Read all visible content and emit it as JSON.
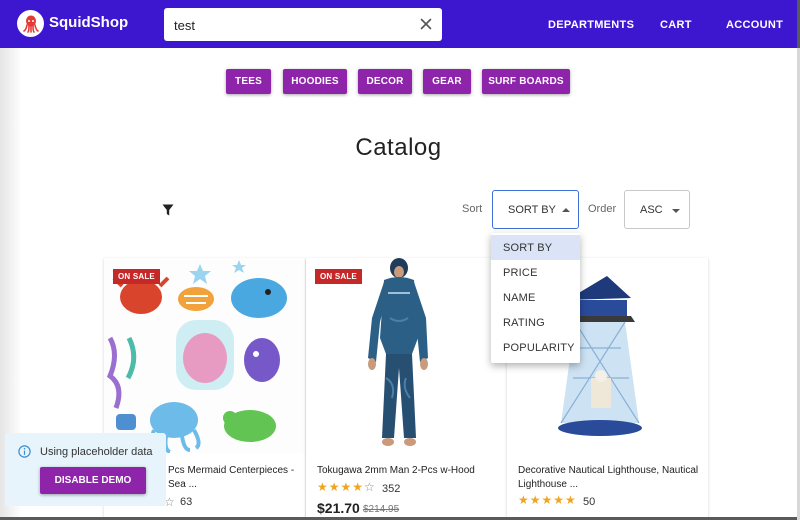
{
  "app": {
    "brand": "SquidShop",
    "logo_icon": "squid-logo-icon"
  },
  "search": {
    "value": "test",
    "clear_icon": "close-icon"
  },
  "nav": {
    "departments": "DEPARTMENTS",
    "cart": "CART",
    "account": "ACCOUNT"
  },
  "categories": [
    "TEES",
    "HOODIES",
    "DECOR",
    "GEAR",
    "SURF BOARDS"
  ],
  "catalog": {
    "title": "Catalog",
    "filter_icon": "filter-icon",
    "sort_label": "Sort",
    "sort_value": "SORT BY",
    "order_label": "Order",
    "order_value": "ASC",
    "sort_options": [
      "SORT BY",
      "PRICE",
      "NAME",
      "RATING",
      "POPULARITY"
    ]
  },
  "products": [
    {
      "badge": "ON SALE",
      "name": "Pcs Mermaid Centerpieces - Sea ...",
      "rating": 3,
      "reviews": "63"
    },
    {
      "badge": "ON SALE",
      "name": "Tokugawa 2mm Man 2-Pcs w-Hood",
      "rating": 4,
      "reviews": "352",
      "price": "$21.70",
      "old_price": "$214.95"
    },
    {
      "badge": "",
      "name": "Decorative Nautical Lighthouse, Nautical Lighthouse ...",
      "rating": 5,
      "reviews": "50"
    }
  ],
  "toast": {
    "message": "Using placeholder data",
    "button": "DISABLE DEMO",
    "icon": "info-icon"
  },
  "colors": {
    "appbar": "#3d17cf",
    "accent": "#8e24aa",
    "sale": "#c62828",
    "star": "#f0a520"
  }
}
